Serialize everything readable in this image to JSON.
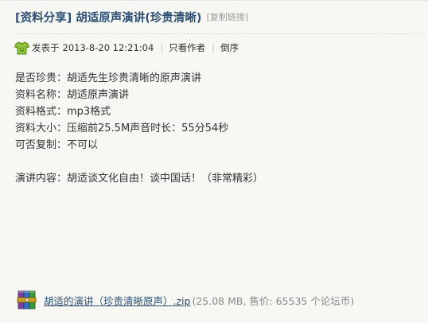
{
  "thread": {
    "title": "[资料分享] 胡适原声演讲(珍贵清晰)",
    "copy_link": "[复制链接]"
  },
  "meta": {
    "posted_prefix": "发表于",
    "posted_time": "2013-8-20 12:21:04",
    "separator": "|",
    "only_author": "只看作者",
    "reverse_order": "倒序"
  },
  "post": {
    "lines": [
      "是否珍贵：胡适先生珍贵清晰的原声演讲",
      "资料名称：胡适原声演讲",
      "资料格式：mp3格式",
      "资料大小：压缩前25.5M声音时长：55分54秒",
      "可否复制：不可以",
      "演讲内容：胡适谈文化自由！谈中国话！（非常精彩）"
    ]
  },
  "attachment": {
    "filename": "胡适的演讲（珍贵清晰原声）.zip",
    "info": "(25.08 MB, 售价: 65535 个论坛币)",
    "icon": "winrar-archive-icon"
  },
  "colors": {
    "title": "#2e4f74",
    "link": "#2e4f74",
    "muted": "#999999",
    "background": "#f7f8f3"
  }
}
